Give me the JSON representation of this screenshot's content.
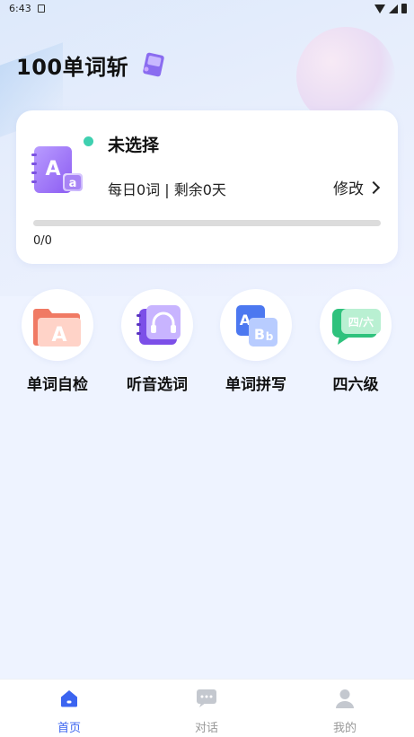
{
  "status_bar": {
    "time": "6:43"
  },
  "header": {
    "title": "100单词斩"
  },
  "plan_card": {
    "title": "未选择",
    "subtitle": "每日0词 | 剩余0天",
    "edit_label": "修改",
    "progress_text": "0/0",
    "progress_fraction": 0
  },
  "features": [
    {
      "label": "单词自检",
      "icon": "letter-a-folder-icon"
    },
    {
      "label": "听音选词",
      "icon": "headphones-notebook-icon"
    },
    {
      "label": "单词拼写",
      "icon": "ab-cards-icon"
    },
    {
      "label": "四六级",
      "icon": "cet-chat-bubble-icon"
    }
  ],
  "tabbar": {
    "items": [
      {
        "label": "首页",
        "icon": "home-icon",
        "active": true
      },
      {
        "label": "对话",
        "icon": "chat-icon",
        "active": false
      },
      {
        "label": "我的",
        "icon": "person-icon",
        "active": false
      }
    ]
  },
  "colors": {
    "accent": "#3b64f0",
    "status_dot": "#3fd0b0",
    "page_bg": "#eef3ff"
  }
}
